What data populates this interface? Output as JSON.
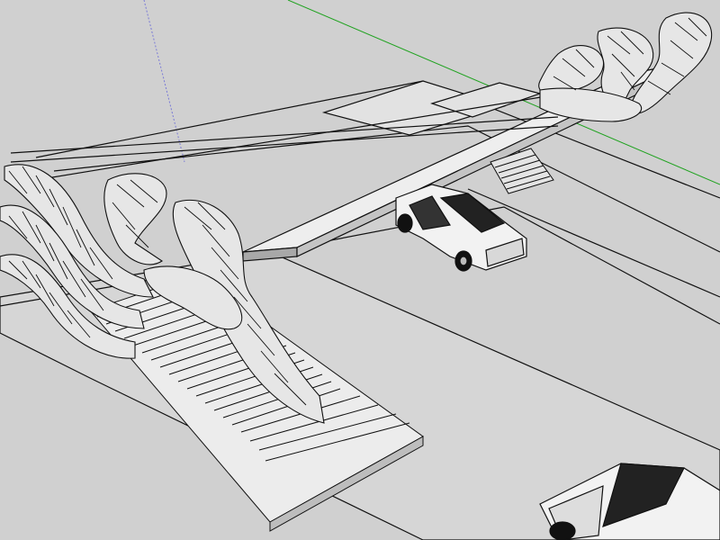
{
  "viewport": {
    "background": "#d0d0d0",
    "axis_colors": {
      "green": "#22a322",
      "blue": "#7a7ad6"
    },
    "edge_color": "#111111",
    "face_light": "#e8e8e8",
    "face_mid": "#c8c8c8",
    "face_dark": "#9a9a9a"
  },
  "scene": {
    "objects": [
      {
        "name": "road-ground"
      },
      {
        "name": "footbridge-deck"
      },
      {
        "name": "stair-left"
      },
      {
        "name": "stair-right"
      },
      {
        "name": "hand-sculpture-left"
      },
      {
        "name": "hand-sculpture-right"
      },
      {
        "name": "car-upper"
      },
      {
        "name": "car-lower"
      }
    ]
  }
}
